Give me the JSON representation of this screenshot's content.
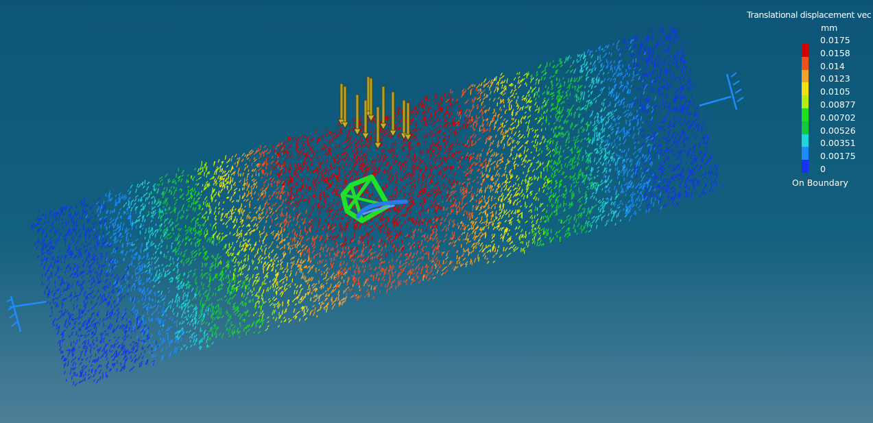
{
  "viewer": {
    "background_top": "#0c5578",
    "background_bottom": "#4e7f98"
  },
  "legend": {
    "title": "Translational displacement vec",
    "unit": "mm",
    "values": [
      "0.0175",
      "0.0158",
      "0.014",
      "0.0123",
      "0.0105",
      "0.00877",
      "0.00702",
      "0.00526",
      "0.00351",
      "0.00175",
      "0"
    ],
    "colors": [
      "#d40000",
      "#f0501e",
      "#f5a028",
      "#f5e014",
      "#b4ec14",
      "#1ee01e",
      "#14c83c",
      "#1ed7d7",
      "#1e8cff",
      "#1432f0"
    ],
    "footer": "On Boundary"
  },
  "scene": {
    "result_type": "displacement vector field",
    "icons": [
      "clamp-restraint-icon",
      "distributed-force-arrows-icon",
      "axis-triad-icon"
    ]
  }
}
